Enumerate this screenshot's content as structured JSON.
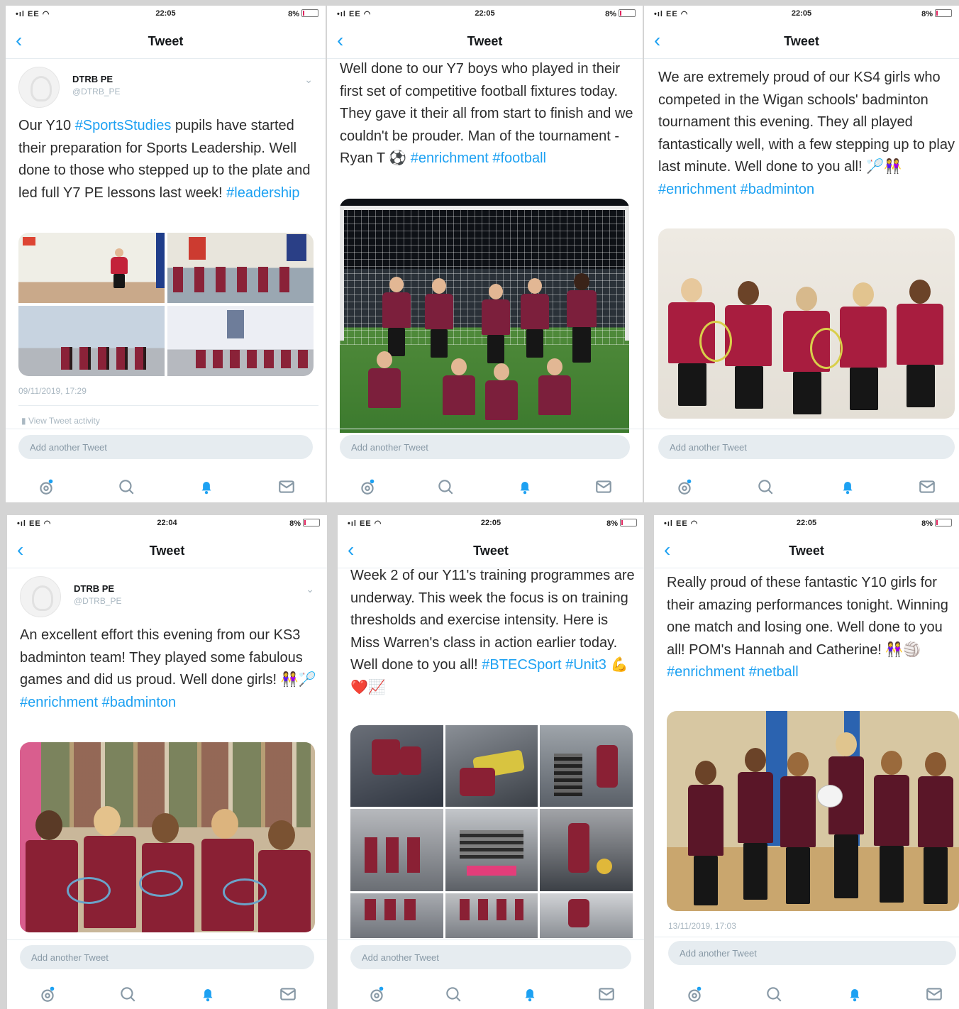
{
  "screens": [
    {
      "status": {
        "signal": "EE",
        "time": "22:05",
        "battery": "8%"
      },
      "nav": {
        "title": "Tweet"
      },
      "author": {
        "name": "DTRB PE",
        "handle": "@DTRB_PE"
      },
      "text_parts": [
        "Our Y10 ",
        "#SportsStudies",
        " pupils have started their preparation for Sports Leadership. Well done to those who stepped up to the plate and led full Y7 PE lessons last week! ",
        "#leadership"
      ],
      "timestamp": "09/11/2019, 17:29",
      "activity": "View Tweet activity",
      "compose_placeholder": "Add another Tweet"
    },
    {
      "status": {
        "signal": "EE",
        "time": "22:05",
        "battery": "8%"
      },
      "nav": {
        "title": "Tweet"
      },
      "text_parts": [
        "Well done to our Y7 boys who played in their first set of competitive football fixtures today. They gave it their all from start to finish and we couldn't be prouder. Man of the tournament - Ryan T ⚽ ",
        "#enrichment #football",
        ""
      ],
      "compose_placeholder": "Add another Tweet"
    },
    {
      "status": {
        "signal": "EE",
        "time": "22:05",
        "battery": "8%"
      },
      "nav": {
        "title": "Tweet"
      },
      "text_parts": [
        "We are extremely proud of our KS4 girls who competed in the Wigan schools' badminton tournament this evening. They all played fantastically well, with a few stepping up to play last minute. Well done to you all! 🏸👭 ",
        "#enrichment #badminton",
        ""
      ],
      "compose_placeholder": "Add another Tweet"
    },
    {
      "status": {
        "signal": "EE",
        "time": "22:04",
        "battery": "8%"
      },
      "nav": {
        "title": "Tweet"
      },
      "author": {
        "name": "DTRB PE",
        "handle": "@DTRB_PE"
      },
      "text_parts": [
        "An excellent effort this evening from our KS3 badminton team! They played some fabulous games and did us proud. Well done girls! 👭🏸 ",
        "#enrichment #badminton",
        ""
      ],
      "compose_placeholder": "Add another Tweet"
    },
    {
      "status": {
        "signal": "EE",
        "time": "22:05",
        "battery": "8%"
      },
      "nav": {
        "title": "Tweet"
      },
      "text_parts": [
        "Week 2 of our Y11's training programmes are underway. This week the focus is on training thresholds and exercise intensity. Here is Miss Warren's class in action earlier today. Well done to you all! ",
        "#BTECSport #Unit3",
        " 💪❤️📈"
      ],
      "compose_placeholder": "Add another Tweet"
    },
    {
      "status": {
        "signal": "EE",
        "time": "22:05",
        "battery": "8%"
      },
      "nav": {
        "title": "Tweet"
      },
      "text_parts": [
        "Really proud of these fantastic Y10 girls  for their amazing performances tonight. Winning one match and losing one. Well done to you all! POM's Hannah and Catherine! 👭🏐 ",
        "#enrichment #netball",
        ""
      ],
      "timestamp": "13/11/2019, 17:03",
      "compose_placeholder": "Add another Tweet"
    }
  ],
  "tabbar": {
    "icons": [
      "home-icon",
      "search-icon",
      "notifications-icon",
      "messages-icon"
    ]
  },
  "colors": {
    "accent": "#1da1f2",
    "kit_maroon": "#7c1f3c"
  }
}
